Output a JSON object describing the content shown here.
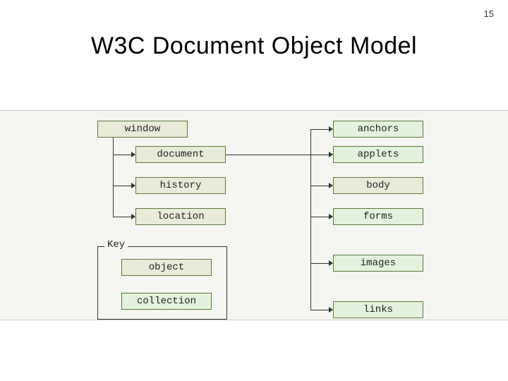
{
  "page_number": "15",
  "title": "W3C Document Object Model",
  "key_label": "Key",
  "key": {
    "object_label": "object",
    "collection_label": "collection"
  },
  "nodes": {
    "window": "window",
    "document": "document",
    "history": "history",
    "location": "location",
    "anchors": "anchors",
    "applets": "applets",
    "body": "body",
    "forms": "forms",
    "images": "images",
    "links": "links"
  }
}
